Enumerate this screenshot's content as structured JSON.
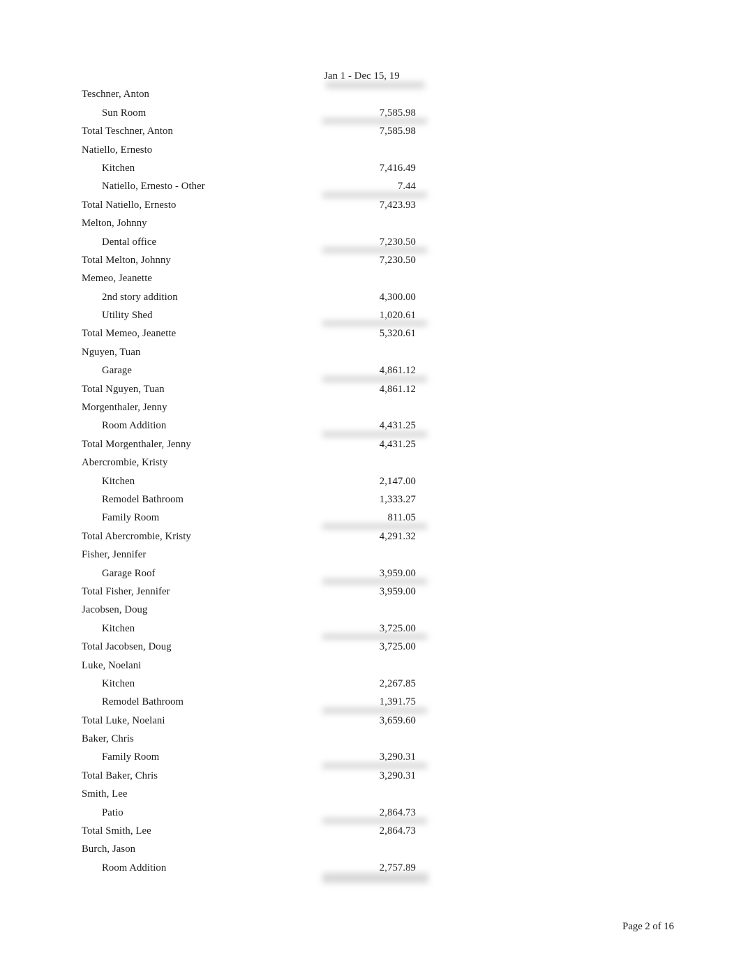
{
  "report": {
    "period_header": "Jan 1 - Dec 15, 19",
    "rows": [
      {
        "label": "Teschner, Anton",
        "amount": "",
        "level": 0,
        "kind": "customer"
      },
      {
        "label": "Sun Room",
        "amount": "7,585.98",
        "level": 1,
        "kind": "job",
        "rule": true
      },
      {
        "label": "Total Teschner, Anton",
        "amount": "7,585.98",
        "level": 0,
        "kind": "total"
      },
      {
        "label": "Natiello, Ernesto",
        "amount": "",
        "level": 0,
        "kind": "customer"
      },
      {
        "label": "Kitchen",
        "amount": "7,416.49",
        "level": 1,
        "kind": "job"
      },
      {
        "label": "Natiello, Ernesto - Other",
        "amount": "7.44",
        "level": 1,
        "kind": "job",
        "rule": true
      },
      {
        "label": "Total Natiello, Ernesto",
        "amount": "7,423.93",
        "level": 0,
        "kind": "total"
      },
      {
        "label": "Melton, Johnny",
        "amount": "",
        "level": 0,
        "kind": "customer"
      },
      {
        "label": "Dental office",
        "amount": "7,230.50",
        "level": 1,
        "kind": "job",
        "rule": true
      },
      {
        "label": "Total Melton, Johnny",
        "amount": "7,230.50",
        "level": 0,
        "kind": "total"
      },
      {
        "label": "Memeo, Jeanette",
        "amount": "",
        "level": 0,
        "kind": "customer"
      },
      {
        "label": "2nd story addition",
        "amount": "4,300.00",
        "level": 1,
        "kind": "job"
      },
      {
        "label": "Utility Shed",
        "amount": "1,020.61",
        "level": 1,
        "kind": "job",
        "rule": true
      },
      {
        "label": "Total Memeo, Jeanette",
        "amount": "5,320.61",
        "level": 0,
        "kind": "total"
      },
      {
        "label": "Nguyen, Tuan",
        "amount": "",
        "level": 0,
        "kind": "customer"
      },
      {
        "label": "Garage",
        "amount": "4,861.12",
        "level": 1,
        "kind": "job",
        "rule": true
      },
      {
        "label": "Total Nguyen, Tuan",
        "amount": "4,861.12",
        "level": 0,
        "kind": "total"
      },
      {
        "label": "Morgenthaler, Jenny",
        "amount": "",
        "level": 0,
        "kind": "customer"
      },
      {
        "label": "Room Addition",
        "amount": "4,431.25",
        "level": 1,
        "kind": "job",
        "rule": true
      },
      {
        "label": "Total Morgenthaler, Jenny",
        "amount": "4,431.25",
        "level": 0,
        "kind": "total"
      },
      {
        "label": "Abercrombie, Kristy",
        "amount": "",
        "level": 0,
        "kind": "customer"
      },
      {
        "label": "Kitchen",
        "amount": "2,147.00",
        "level": 1,
        "kind": "job"
      },
      {
        "label": "Remodel Bathroom",
        "amount": "1,333.27",
        "level": 1,
        "kind": "job"
      },
      {
        "label": "Family Room",
        "amount": "811.05",
        "level": 1,
        "kind": "job",
        "rule": true
      },
      {
        "label": "Total Abercrombie, Kristy",
        "amount": "4,291.32",
        "level": 0,
        "kind": "total"
      },
      {
        "label": "Fisher, Jennifer",
        "amount": "",
        "level": 0,
        "kind": "customer"
      },
      {
        "label": "Garage Roof",
        "amount": "3,959.00",
        "level": 1,
        "kind": "job",
        "rule": true
      },
      {
        "label": "Total Fisher, Jennifer",
        "amount": "3,959.00",
        "level": 0,
        "kind": "total"
      },
      {
        "label": "Jacobsen, Doug",
        "amount": "",
        "level": 0,
        "kind": "customer"
      },
      {
        "label": "Kitchen",
        "amount": "3,725.00",
        "level": 1,
        "kind": "job",
        "rule": true
      },
      {
        "label": "Total Jacobsen, Doug",
        "amount": "3,725.00",
        "level": 0,
        "kind": "total"
      },
      {
        "label": "Luke, Noelani",
        "amount": "",
        "level": 0,
        "kind": "customer"
      },
      {
        "label": "Kitchen",
        "amount": "2,267.85",
        "level": 1,
        "kind": "job"
      },
      {
        "label": "Remodel Bathroom",
        "amount": "1,391.75",
        "level": 1,
        "kind": "job",
        "rule": true
      },
      {
        "label": "Total Luke, Noelani",
        "amount": "3,659.60",
        "level": 0,
        "kind": "total"
      },
      {
        "label": "Baker, Chris",
        "amount": "",
        "level": 0,
        "kind": "customer"
      },
      {
        "label": "Family Room",
        "amount": "3,290.31",
        "level": 1,
        "kind": "job",
        "rule": true
      },
      {
        "label": "Total Baker, Chris",
        "amount": "3,290.31",
        "level": 0,
        "kind": "total"
      },
      {
        "label": "Smith, Lee",
        "amount": "",
        "level": 0,
        "kind": "customer"
      },
      {
        "label": "Patio",
        "amount": "2,864.73",
        "level": 1,
        "kind": "job",
        "rule": true
      },
      {
        "label": "Total Smith, Lee",
        "amount": "2,864.73",
        "level": 0,
        "kind": "total"
      },
      {
        "label": "Burch, Jason",
        "amount": "",
        "level": 0,
        "kind": "customer"
      },
      {
        "label": "Room Addition",
        "amount": "2,757.89",
        "level": 1,
        "kind": "job",
        "rule": "tall"
      }
    ]
  },
  "footer": {
    "page_label": "Page 2 of 16"
  }
}
